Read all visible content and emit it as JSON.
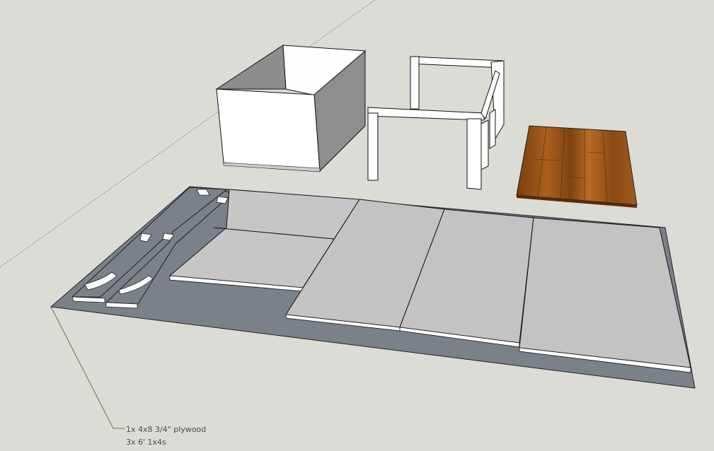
{
  "canvas": {
    "background_color": "#dcdcd7",
    "axis_line_color": "#7a7a6e"
  },
  "annotation": {
    "line1": "1x 4x8 3/4\" plywood",
    "line2": "3x 6' 1x4s",
    "leader_color": "#8a6a44"
  },
  "colors": {
    "plywood_base": "#7a8088",
    "panel_gray": "#c3c3c3",
    "panel_white": "#ffffff",
    "box_dark": "#8d8d8d",
    "box_mid": "#a8a8a8",
    "floor_wood": "#8b4a13"
  }
}
